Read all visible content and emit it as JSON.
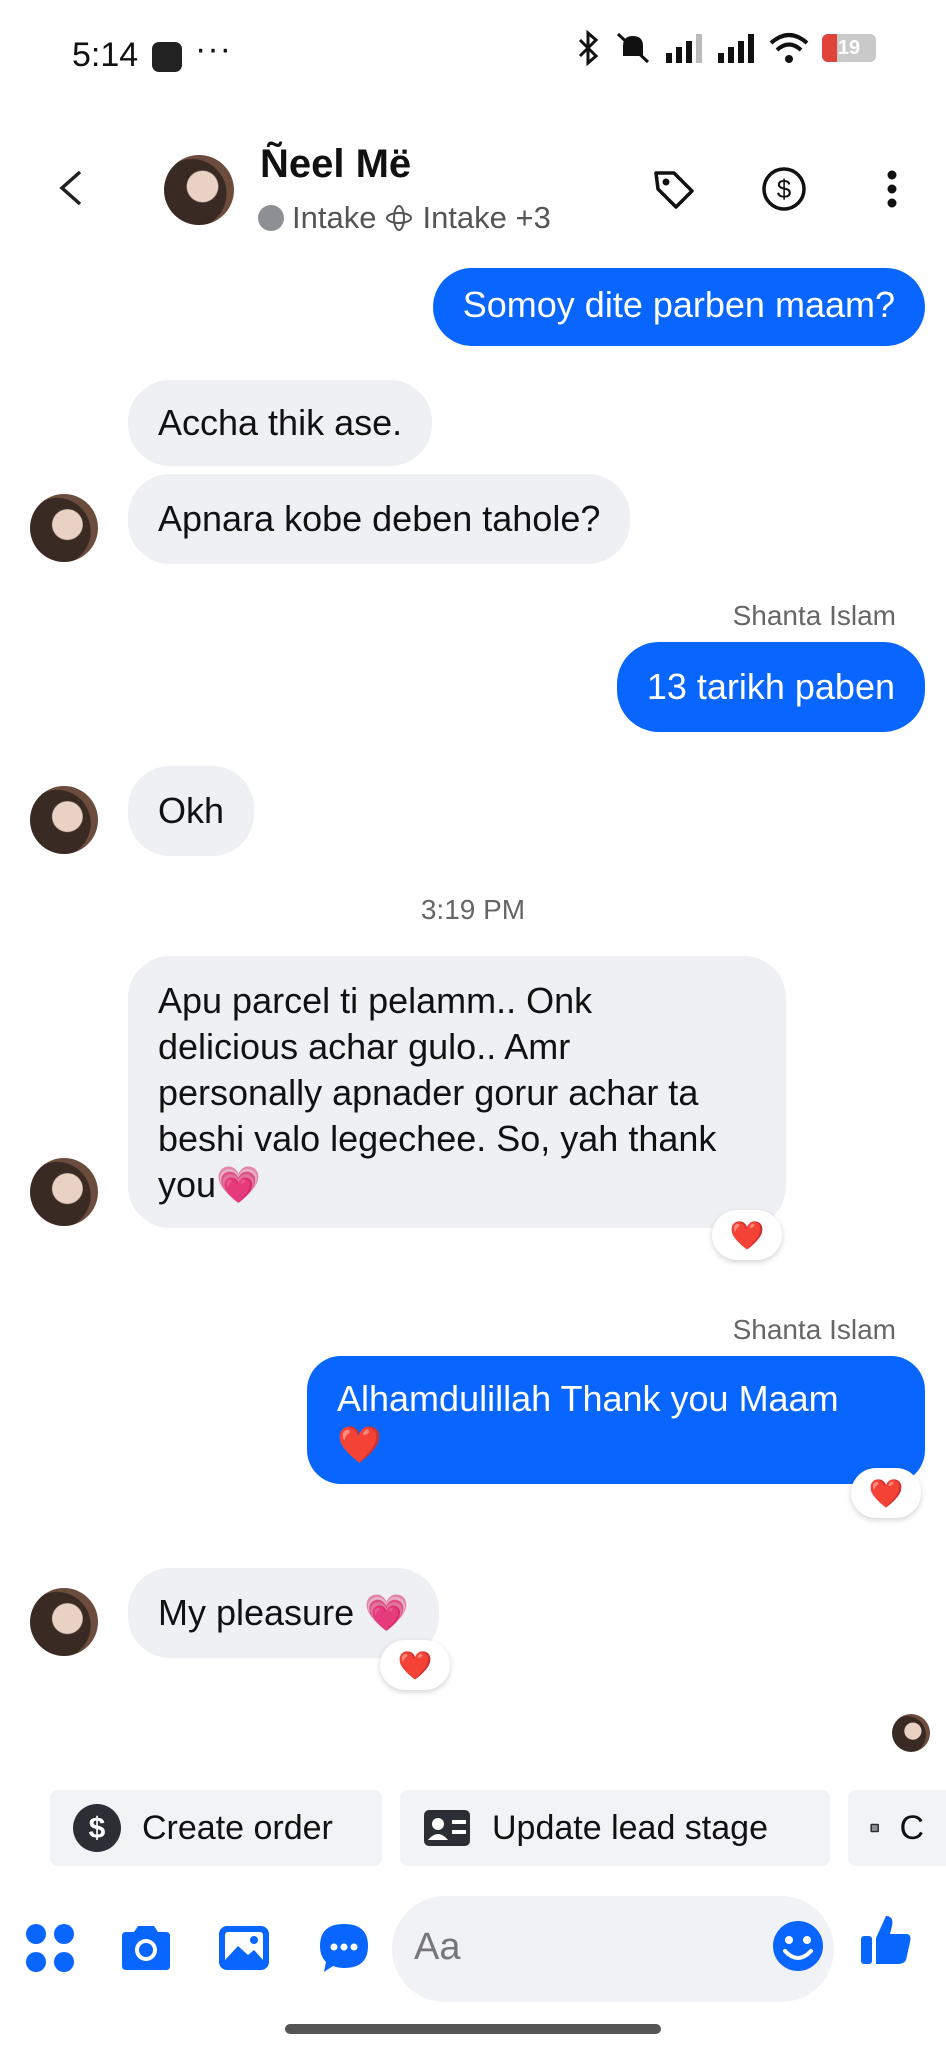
{
  "status": {
    "time": "5:14",
    "dots": "···",
    "battery": "19"
  },
  "header": {
    "name": "Ñeel Më",
    "label1": "Intake",
    "label2": "Intake +3"
  },
  "messages": {
    "m1": "Somoy dite parben maam?",
    "m2": "Accha thik ase.",
    "m3": "Apnara kobe deben tahole?",
    "sender1": "Shanta Islam",
    "m4": "13 tarikh paben",
    "m5": "Okh",
    "time1": "3:19 PM",
    "m6_l1": "Apu parcel ti pelamm.. Onk",
    "m6_l2": "delicious achar gulo.. Amr",
    "m6_l3": "personally apnader gorur achar ta",
    "m6_l4": "beshi valo legechee. So, yah thank",
    "m6_l5": "you💗",
    "sender2": "Shanta Islam",
    "m7_l1": "Alhamdulillah  Thank you Maam",
    "m7_l2": "❤️",
    "m8": "My pleasure 💗",
    "reaction": "❤️"
  },
  "quick_actions": {
    "create_order": "Create order",
    "update_lead": "Update lead stage",
    "partial": "C"
  },
  "composer": {
    "placeholder": "Aa"
  },
  "colors": {
    "accent": "#0866ff",
    "incoming": "#eef0f3"
  }
}
